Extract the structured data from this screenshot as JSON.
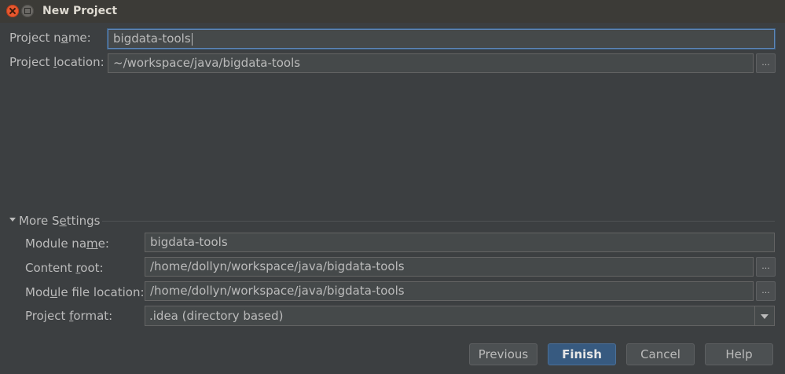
{
  "window": {
    "title": "New Project"
  },
  "project": {
    "name_label_pre": "Project n",
    "name_label_mn": "a",
    "name_label_post": "me:",
    "name_value": "bigdata-tools",
    "location_label_pre": "Project ",
    "location_label_mn": "l",
    "location_label_post": "ocation:",
    "location_value": "~/workspace/java/bigdata-tools",
    "browse_label": "..."
  },
  "more_settings": {
    "toggle_pre": "More S",
    "toggle_mn": "e",
    "toggle_post": "ttings",
    "module_name_label_pre": "Module na",
    "module_name_label_mn": "m",
    "module_name_label_post": "e:",
    "module_name_value": "bigdata-tools",
    "content_root_label_pre": "Content ",
    "content_root_label_mn": "r",
    "content_root_label_post": "oot:",
    "content_root_value": "/home/dollyn/workspace/java/bigdata-tools",
    "module_file_label_pre": "Mod",
    "module_file_label_mn": "u",
    "module_file_label_post": "le file location:",
    "module_file_value": "/home/dollyn/workspace/java/bigdata-tools",
    "project_format_label_pre": "Project ",
    "project_format_label_mn": "f",
    "project_format_label_post": "ormat:",
    "project_format_value": ".idea (directory based)",
    "browse_label": "..."
  },
  "buttons": {
    "previous": "Previous",
    "finish": "Finish",
    "cancel": "Cancel",
    "help": "Help"
  },
  "colors": {
    "background": "#3c3f41",
    "titlebar": "#3c3b37",
    "primary_button": "#375a80",
    "focus_border": "#5e86b8",
    "close_button": "#e8582f"
  }
}
